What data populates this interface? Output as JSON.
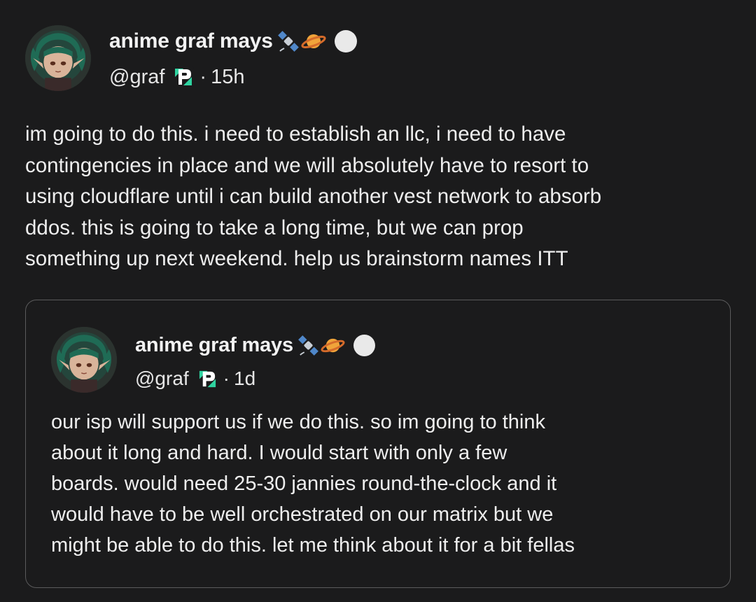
{
  "post": {
    "author": {
      "display_name": "anime graf mays",
      "handle": "@graf",
      "time": "15h",
      "separator": "·"
    },
    "body": "im going to do this. i need to establish an llc, i need to have\ncontingencies in place and we will absolutely have to resort to\nusing cloudflare until i can build another vest network to absorb\nddos. this is going to take a long time, but we can prop\nsomething up next weekend. help us brainstorm names ITT"
  },
  "quoted_post": {
    "author": {
      "display_name": "anime graf mays",
      "handle": "@graf",
      "time": "1d",
      "separator": "·"
    },
    "body": "our isp will support us if we do this. so im going to think\nabout it long and hard. I would start with only a few\nboards. would need 25-30 jannies round-the-clock and it\nwould have to be well orchestrated on our matrix but we\nmight be able to do this. let me think about it for a bit fellas"
  },
  "icons": {
    "name_emoji": [
      "satellite-icon",
      "ringed-planet-icon"
    ],
    "status": "status-circle-icon",
    "badge": "p-badge-icon"
  },
  "colors": {
    "background": "#1b1b1c",
    "text": "#eeeeee",
    "quote_border": "#5b5b5c",
    "badge_green": "#2fd3a0"
  }
}
